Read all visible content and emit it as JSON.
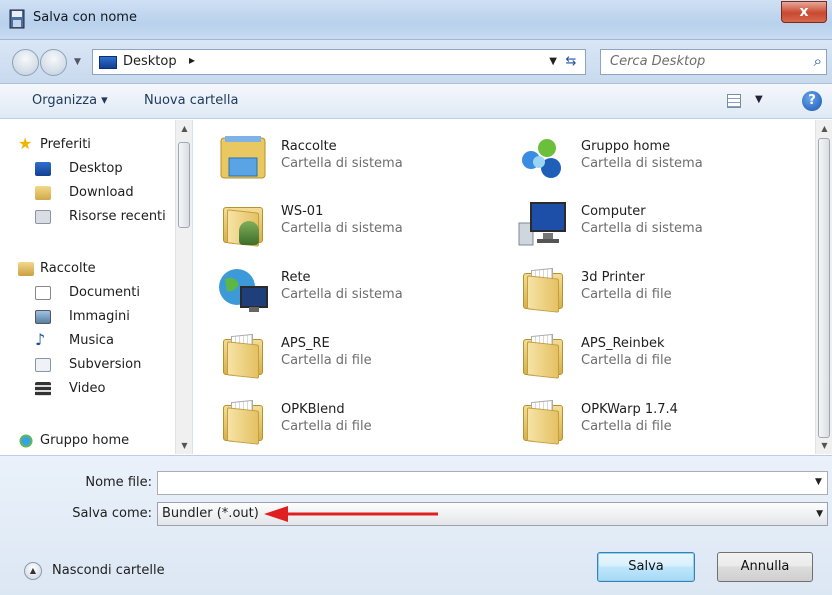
{
  "window": {
    "title": "Salva con nome",
    "close_glyph": "x"
  },
  "address": {
    "location": "Desktop",
    "separator": "▸",
    "search_placeholder": "Cerca Desktop"
  },
  "commands": {
    "organize": "Organizza ▾",
    "new_folder": "Nuova cartella"
  },
  "nav": {
    "favorites_group": "Preferiti",
    "favorites": [
      "Desktop",
      "Download",
      "Risorse recenti"
    ],
    "libraries_group": "Raccolte",
    "libraries": [
      "Documenti",
      "Immagini",
      "Musica",
      "Subversion",
      "Video"
    ],
    "homegroup": "Gruppo home"
  },
  "items": [
    {
      "name": "Raccolte",
      "type": "Cartella di sistema",
      "icon": "libraries-icon"
    },
    {
      "name": "Gruppo home",
      "type": "Cartella di sistema",
      "icon": "homegroup-icon"
    },
    {
      "name": "WS-01",
      "type": "Cartella di sistema",
      "icon": "user-folder-icon"
    },
    {
      "name": "Computer",
      "type": "Cartella di sistema",
      "icon": "computer-icon"
    },
    {
      "name": "Rete",
      "type": "Cartella di sistema",
      "icon": "network-icon"
    },
    {
      "name": "3d Printer",
      "type": "Cartella di file",
      "icon": "folder-icon"
    },
    {
      "name": "APS_RE",
      "type": "Cartella di file",
      "icon": "folder-icon"
    },
    {
      "name": "APS_Reinbek",
      "type": "Cartella di file",
      "icon": "folder-icon"
    },
    {
      "name": "OPKBlend",
      "type": "Cartella di file",
      "icon": "folder-icon"
    },
    {
      "name": "OPKWarp 1.7.4",
      "type": "Cartella di file",
      "icon": "folder-icon"
    }
  ],
  "form": {
    "filename_label": "Nome file:",
    "filename_value": "",
    "filetype_label": "Salva come:",
    "filetype_value": "Bundler (*.out)"
  },
  "footer": {
    "hide_folders": "Nascondi cartelle",
    "save": "Salva",
    "cancel": "Annulla"
  },
  "colors": {
    "arrow": "#e02020",
    "accent": "#3c7fb1"
  }
}
